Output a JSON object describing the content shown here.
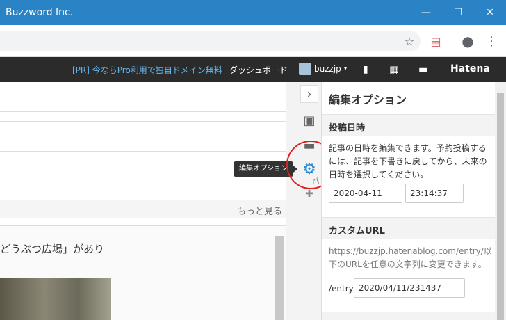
{
  "window": {
    "title": "Buzzword Inc.",
    "minimize_glyph": "—",
    "maximize_glyph": "☐",
    "close_glyph": "✕"
  },
  "toolbar": {
    "star_glyph": "☆",
    "profile_glyph": "●",
    "menu_glyph": "⋮",
    "extension_glyph": "▤"
  },
  "hatena_bar": {
    "pr_text": "[PR] 今ならPro利用で独自ドメイン無料",
    "dashboard": "ダッシュボード",
    "username": "buzzjp",
    "logo": "Hatena",
    "bookmark_glyph": "▮",
    "apps_glyph": "▦",
    "comment_glyph": "▬"
  },
  "editor": {
    "more_link": "もっと見る",
    "card_text": "どうぶつ広場」があり"
  },
  "sidetool": {
    "chevron_glyph": "›",
    "image_glyph": "▣",
    "folder_glyph": "▬",
    "gear_glyph": "⚙",
    "plus_glyph": "✚",
    "tooltip": "編集オプション"
  },
  "panel": {
    "title": "編集オプション",
    "date_section": {
      "heading": "投稿日時",
      "description": "記事の日時を編集できます。予約投稿するには、記事を下書きに戻してから、未来の日時を選択してください。",
      "date_value": "2020-04-11",
      "time_value": "23:14:37"
    },
    "url_section": {
      "heading": "カスタムURL",
      "description": "https://buzzjp.hatenablog.com/entry/以下のURLを任意の文字列に変更できます。",
      "prefix_label": "/entry/",
      "url_value": "2020/04/11/231437"
    }
  },
  "colors": {
    "titlebar": "#2a83c4",
    "hatena_bar": "#2b2b2b",
    "pr_link": "#62b6ee",
    "gear_accent": "#2a8ad4",
    "highlight": "#e02020"
  }
}
